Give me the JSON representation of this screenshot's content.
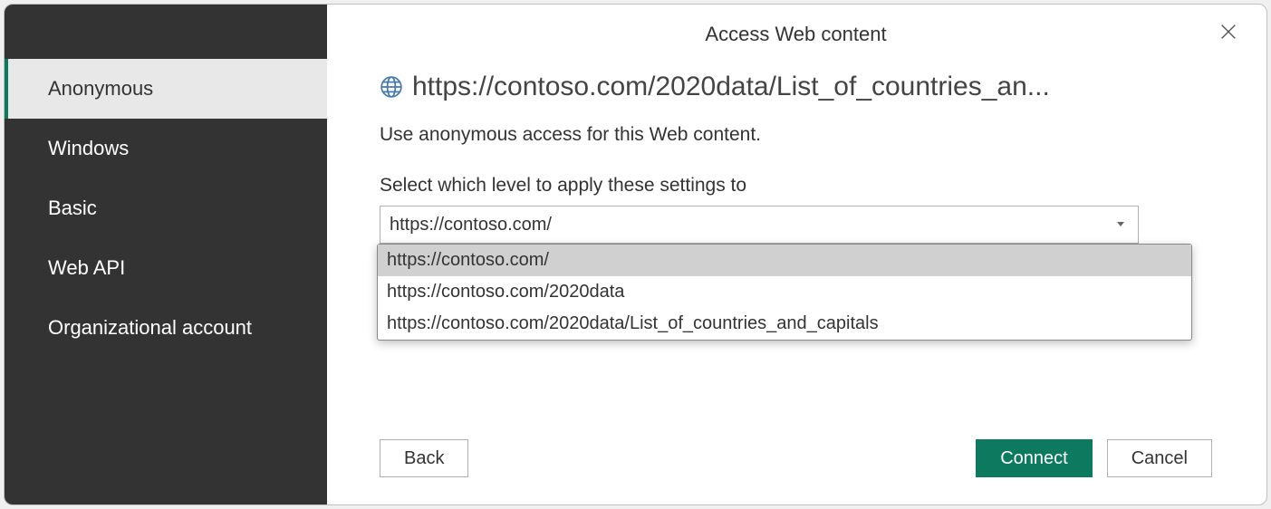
{
  "dialog": {
    "title": "Access Web content"
  },
  "sidebar": {
    "items": [
      {
        "label": "Anonymous",
        "selected": true
      },
      {
        "label": "Windows",
        "selected": false
      },
      {
        "label": "Basic",
        "selected": false
      },
      {
        "label": "Web API",
        "selected": false
      },
      {
        "label": "Organizational account",
        "selected": false
      }
    ]
  },
  "main": {
    "url": "https://contoso.com/2020data/List_of_countries_an...",
    "description": "Use anonymous access for this Web content.",
    "level_label": "Select which level to apply these settings to",
    "level_selected": "https://contoso.com/",
    "level_options": [
      "https://contoso.com/",
      "https://contoso.com/2020data",
      "https://contoso.com/2020data/List_of_countries_and_capitals"
    ]
  },
  "buttons": {
    "back": "Back",
    "connect": "Connect",
    "cancel": "Cancel"
  },
  "colors": {
    "accent": "#0d7a5f",
    "sidebar_bg": "#333333"
  }
}
